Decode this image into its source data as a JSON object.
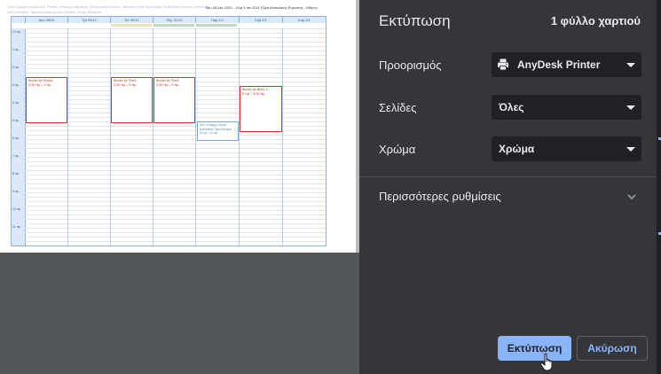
{
  "panel": {
    "title": "Εκτύπωση",
    "sheet_count": "1 φύλλο χαρτιού"
  },
  "settings": {
    "destination": {
      "label": "Προορισμός",
      "value": "AnyDesk Printer",
      "icon": "printer-icon"
    },
    "pages": {
      "label": "Σελίδες",
      "value": "Όλες"
    },
    "color": {
      "label": "Χρώμα",
      "value": "Χρώμα"
    },
    "more": {
      "label": "Περισσότερες ρυθμίσεις",
      "icon": "chevron-down-icon"
    }
  },
  "buttons": {
    "print": "Εκτύπωση",
    "cancel": "Ακύρωση"
  },
  "colors": {
    "panel_bg": "#35363a",
    "select_bg": "#202124",
    "accent": "#8ab4f8",
    "event_red": "#d03a2a",
    "event_blue": "#7aa6d8",
    "calendar_header": "#dbe8f8"
  },
  "preview": {
    "header_left": "Χίου Γιώργος Χρυσούλα, Ρίτσας, Μπουχς Δημήτρης (Ολυμπιακό Στάδιο), Δικαστές στην Κυλλινδρο, Καλλιθέας αγώνες, Μπάσκετ στη Καλλιθέα, Προπονητική αγωνία, Athlete Group Μπάσκετ",
    "header_right": "Δευ 28 Δεκ 2020 – Κυρ 3 Ιαν 2021 (Ώρα Ανατολικής Ευρώπης - Αθήνα)",
    "days": [
      "Δευ 28/12",
      "Τρί 29/12",
      "Τετ 30/12",
      "Πέμ 31/12",
      "Παρ 1/1",
      "Σάβ 2/1",
      "Κυρ 3/1"
    ],
    "hours": [
      "12 πμ",
      "1 πμ",
      "2 πμ",
      "3 πμ",
      "4 πμ",
      "5 πμ",
      "6 πμ",
      "7 πμ",
      "8 πμ",
      "9 πμ",
      "10 πμ",
      "11 πμ"
    ],
    "events": [
      {
        "title": "Βούλα @ Κούλα",
        "time": "2:30 πμ – 5 πμ"
      },
      {
        "title": "Βούλα @ Παύλ",
        "time": "2:30 πμ – 5 πμ"
      },
      {
        "title": "Βούλα @ Παύλ",
        "time": "2:30 πμ – 5 πμ"
      },
      {
        "title": "Βούλα @ Βούλ 1",
        "time": "3 πμ – 5:30 πμ"
      },
      {
        "title": "Δεν υπάρχει θέμα Καλλιθέα Πρόσκληση",
        "time": "5 πμ – 6 πμ"
      }
    ]
  }
}
